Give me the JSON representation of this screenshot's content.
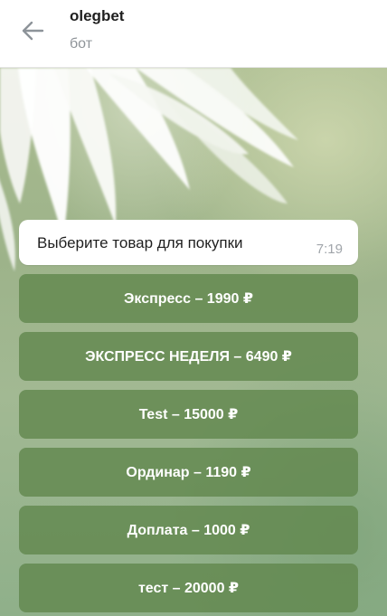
{
  "header": {
    "title": "olegbet",
    "subtitle": "бот",
    "back_icon": "arrow-left-icon"
  },
  "colors": {
    "header_bg": "#ffffff",
    "bubble_bg": "#ffffff",
    "button_bg": "#62884e",
    "button_text": "#ffffff",
    "time_text": "#a0a5aa"
  },
  "message": {
    "text": "Выберите товар для покупки",
    "time": "7:19"
  },
  "keyboard": {
    "buttons": [
      "Экспресс – 1990 ₽",
      "ЭКСПРЕСС НЕДЕЛЯ – 6490 ₽",
      "Test – 15000 ₽",
      "Ординар – 1190 ₽",
      "Доплата – 1000 ₽",
      "тест – 20000 ₽"
    ]
  }
}
